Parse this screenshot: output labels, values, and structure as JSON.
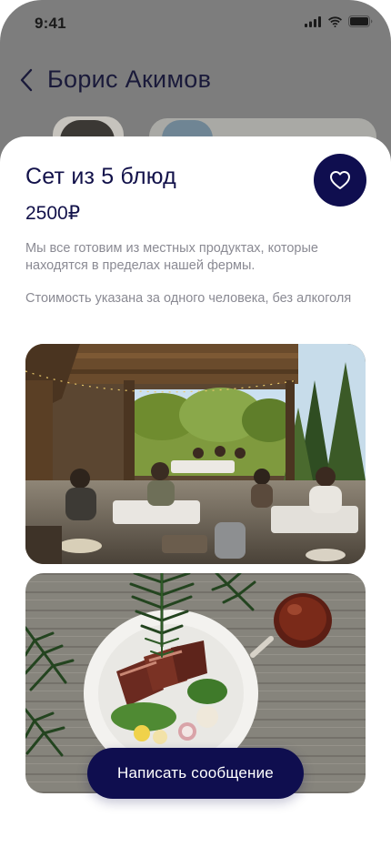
{
  "status_bar": {
    "time": "9:41"
  },
  "background_screen": {
    "title": "Борис Акимов",
    "back_icon": "chevron-left-icon"
  },
  "sheet": {
    "title": "Сет из 5 блюд",
    "price": "2500₽",
    "favorite_icon": "heart-icon",
    "description_1": "Мы все готовим из местных продуктах, которые находятся в пределах нашей фермы.",
    "description_2": "Стоимость указана за одного человека, без алкоголя",
    "photos": [
      {
        "subject": "outdoor-dining-photo"
      },
      {
        "subject": "meat-plate-photo"
      }
    ],
    "cta_label": "Написать сообщение"
  },
  "colors": {
    "accent": "#0f0e4f",
    "text_primary": "#12114a",
    "text_secondary": "#8a8a93",
    "overlay": "#7d7d7d"
  }
}
